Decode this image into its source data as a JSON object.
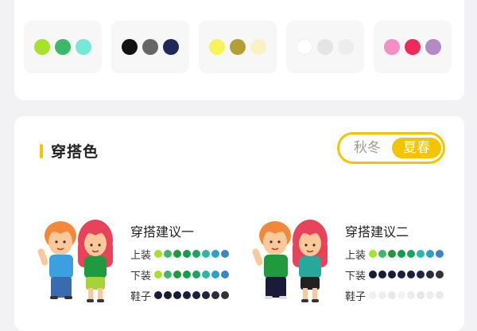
{
  "palette": [
    {
      "colors": [
        "#a6e22a",
        "#3bb86a",
        "#76e8d8"
      ]
    },
    {
      "colors": [
        "#111111",
        "#666666",
        "#1e2a5a"
      ]
    },
    {
      "colors": [
        "#f7f35a",
        "#b3a035",
        "#fbf2c4"
      ]
    },
    {
      "colors": [
        "#ffffff",
        "#e5e5e5",
        "#ededed"
      ]
    },
    {
      "colors": [
        "#f48fc4",
        "#ee2a5a",
        "#b48ac4"
      ]
    }
  ],
  "section": {
    "title": "穿搭色"
  },
  "season_toggle": {
    "options": [
      "秋冬",
      "夏春"
    ],
    "selected": "夏春"
  },
  "suggestions": [
    {
      "title": "穿搭建议一",
      "rows": [
        {
          "label": "上装",
          "colors": [
            "#a6e22a",
            "#3bb86a",
            "#1f9a3e",
            "#139e4a",
            "#1ba660",
            "#2bb8a8",
            "#2aa0d0",
            "#3a84c8"
          ]
        },
        {
          "label": "下装",
          "colors": [
            "#a6e22a",
            "#3bb86a",
            "#1f9a3e",
            "#139e4a",
            "#1ba660",
            "#2bb8a8",
            "#2aa0d0",
            "#3a84c8"
          ]
        },
        {
          "label": "鞋子",
          "colors": [
            "#1a1a3a",
            "#1a1a3a",
            "#1a1a3a",
            "#1e1e40",
            "#1e1e40",
            "#222244",
            "#2a2a40",
            "#333333"
          ]
        }
      ]
    },
    {
      "title": "穿搭建议二",
      "rows": [
        {
          "label": "上装",
          "colors": [
            "#a6e22a",
            "#3bb86a",
            "#1f9a3e",
            "#139e4a",
            "#1ba660",
            "#2bb8a8",
            "#2aa0d0",
            "#3a84c8"
          ]
        },
        {
          "label": "下装",
          "colors": [
            "#1a1a3a",
            "#1a1a3a",
            "#1a1a3a",
            "#1e1e40",
            "#1e1e40",
            "#222244",
            "#2a2a40",
            "#333333"
          ]
        },
        {
          "label": "鞋子",
          "colors": [
            "#f0f0f0",
            "#eeeeee",
            "#e8e8e8",
            "#f3f3f3",
            "#ececec",
            "#e6e6e6",
            "#eeeeee",
            "#e9e9e9"
          ]
        }
      ]
    }
  ],
  "figures": [
    {
      "boy_shirt": "#3aa0e0",
      "boy_pants": "#3a6ab0",
      "girl_top": "#1f9a3e",
      "girl_pants": "#a6d23a"
    },
    {
      "boy_shirt": "#1f9a3e",
      "boy_pants": "#1a1a3a",
      "girl_top": "#26a89a",
      "girl_pants": "#222222"
    }
  ]
}
